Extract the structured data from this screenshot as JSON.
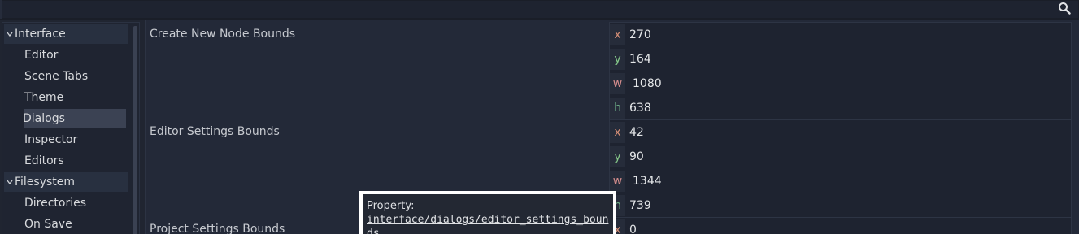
{
  "search": {
    "icon": "search-icon"
  },
  "tree": {
    "items": [
      {
        "label": "Interface",
        "type": "category"
      },
      {
        "label": "Editor",
        "type": "child"
      },
      {
        "label": "Scene Tabs",
        "type": "child"
      },
      {
        "label": "Theme",
        "type": "child"
      },
      {
        "label": "Dialogs",
        "type": "child",
        "selected": true
      },
      {
        "label": "Inspector",
        "type": "child"
      },
      {
        "label": "Editors",
        "type": "child"
      },
      {
        "label": "Filesystem",
        "type": "category"
      },
      {
        "label": "Directories",
        "type": "child"
      },
      {
        "label": "On Save",
        "type": "child"
      }
    ]
  },
  "properties": [
    {
      "name": "Create New Node Bounds",
      "values": [
        {
          "axis": "x",
          "value": "270"
        },
        {
          "axis": "y",
          "value": "164"
        },
        {
          "axis": "w",
          "value": "1080"
        },
        {
          "axis": "h",
          "value": "638"
        }
      ]
    },
    {
      "name": "Editor Settings Bounds",
      "values": [
        {
          "axis": "x",
          "value": "42"
        },
        {
          "axis": "y",
          "value": "90"
        },
        {
          "axis": "w",
          "value": "1344"
        },
        {
          "axis": "h",
          "value": "739"
        }
      ]
    },
    {
      "name": "Project Settings Bounds",
      "values": [
        {
          "axis": "x",
          "value": "0"
        }
      ]
    }
  ],
  "tooltip": {
    "title": "Property:",
    "path": "interface/dialogs/editor_settings_bounds"
  },
  "colors": {
    "background": "#202531",
    "selected": "#3b4253",
    "axis_x": "#d48e76",
    "axis_y": "#86c98a",
    "axis_w": "#d38c8c",
    "axis_h": "#6fb088"
  }
}
